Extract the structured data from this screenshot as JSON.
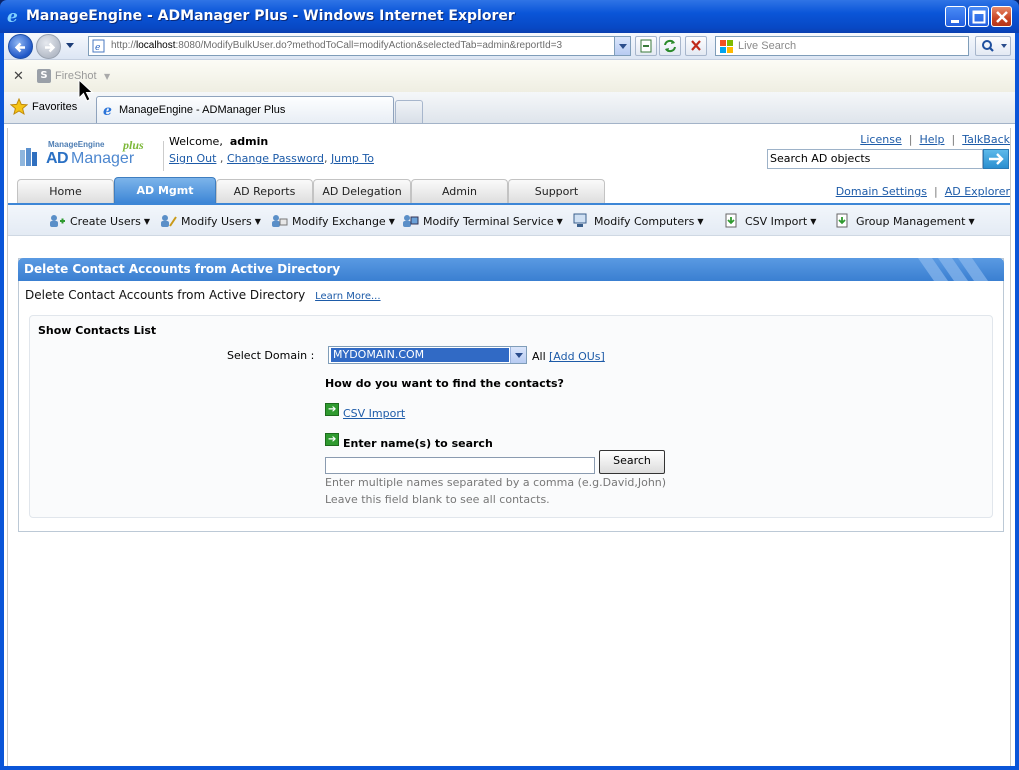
{
  "window": {
    "title": "ManageEngine - ADManager Plus - Windows Internet Explorer"
  },
  "browser": {
    "address_host_prefix": "http://",
    "address_host": "localhost",
    "address_rest": ":8080/ModifyBulkUser.do?methodToCall=modifyAction&selectedTab=admin&reportId=3",
    "live_search_placeholder": "Live Search",
    "fireshot_label": "FireShot",
    "favorites_label": "Favorites",
    "tab_title": "ManageEngine - ADManager Plus"
  },
  "app": {
    "logo": {
      "brand": "ManageEngine",
      "product_ad": "AD",
      "product_mgr": "Manager",
      "plus": "plus"
    },
    "welcome_prefix": "Welcome,",
    "user": "admin",
    "user_links": {
      "sign_out": "Sign Out",
      "change_password": "Change Password",
      "jump_to": "Jump To"
    },
    "top_links": {
      "license": "License",
      "help": "Help",
      "talkback": "TalkBack"
    },
    "search_placeholder": "Search AD objects",
    "tabs": [
      {
        "label": "Home"
      },
      {
        "label": "AD Mgmt"
      },
      {
        "label": "AD Reports"
      },
      {
        "label": "AD Delegation"
      },
      {
        "label": "Admin"
      },
      {
        "label": "Support"
      }
    ],
    "active_tab": "AD Mgmt",
    "domain_links": {
      "domain_settings": "Domain Settings",
      "ad_explorer": "AD Explorer"
    },
    "subnav": [
      {
        "label": "Create Users",
        "icon": "create-users-icon"
      },
      {
        "label": "Modify Users",
        "icon": "modify-users-icon"
      },
      {
        "label": "Modify Exchange",
        "icon": "modify-exchange-icon"
      },
      {
        "label": "Modify Terminal Service",
        "icon": "terminal-service-icon"
      },
      {
        "label": "Modify Computers",
        "icon": "computers-icon"
      },
      {
        "label": "CSV Import",
        "icon": "csv-import-icon"
      },
      {
        "label": "Group Management",
        "icon": "group-management-icon"
      }
    ]
  },
  "panel": {
    "title": "Delete Contact Accounts from Active Directory",
    "subtitle": "Delete Contact Accounts from Active Directory",
    "learn_more": "Learn More...",
    "section_title": "Show Contacts List",
    "domain_label": "Select Domain :",
    "domain_value": "MYDOMAIN.COM",
    "all_label": "All",
    "add_ous": "[Add OUs]",
    "question": "How do you want to find the contacts?",
    "csv_import": "CSV Import",
    "enter_names": "Enter name(s) to search",
    "name_input_value": "",
    "search_button": "Search",
    "hint_line1": "Enter multiple names separated by a comma (e.g.David,John)",
    "hint_line2": "Leave this field blank to see all contacts."
  }
}
